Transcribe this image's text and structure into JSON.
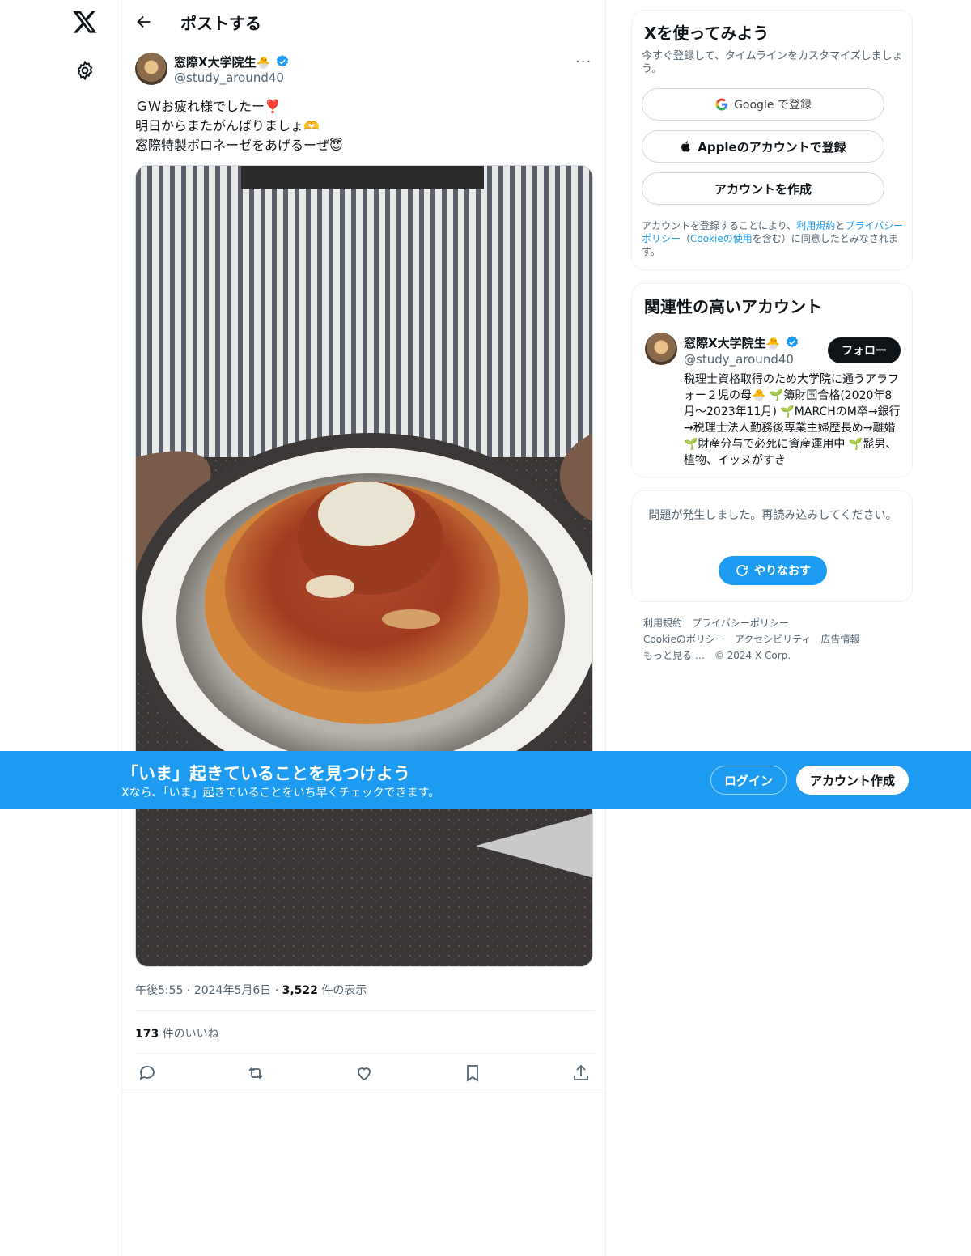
{
  "header": {
    "title": "ポストする"
  },
  "post": {
    "author_name": "窓際X大学院生",
    "author_emoji": "🐣",
    "author_handle": "@study_around40",
    "text_lines": [
      "ＧＷお疲れ様でしたー❣️",
      "明日からまたがんばりましょ🫶",
      "窓際特製ボロネーゼをあげるーぜ😇"
    ],
    "time": "午後5:55",
    "date": "2024年5月6日",
    "views_count": "3,522",
    "views_label": "件の表示",
    "likes_count": "173",
    "likes_label": "件のいいね",
    "more_label": "···"
  },
  "signup_card": {
    "title": "Xを使ってみよう",
    "subtitle": "今すぐ登録して、タイムラインをカスタマイズしましょう。",
    "google_label": "Google で登録",
    "apple_label": "Appleのアカウントで登録",
    "create_label": "アカウントを作成",
    "legal_prefix": "アカウントを登録することにより、",
    "legal_terms": "利用規約",
    "legal_and": "と",
    "legal_privacy": "プライバシーポリシー",
    "legal_paren_open": "（",
    "legal_cookie": "Cookieの使用",
    "legal_suffix": "を含む）に同意したとみなされます。"
  },
  "related": {
    "title": "関連性の高いアカウント",
    "name": "窓際X大学院生",
    "emoji": "🐣",
    "handle": "@study_around40",
    "follow_label": "フォロー",
    "bio": "税理士資格取得のため大学院に通うアラフォー２児の母🐣 🌱簿財国合格(2020年8月〜2023年11月) 🌱MARCHのM卒→銀行→税理士法人勤務後専業主婦歴長め→離婚 🌱財産分与で必死に資産運用中 🌱髭男、植物、イッヌがすき"
  },
  "error_card": {
    "message": "問題が発生しました。再読み込みしてください。",
    "retry_label": "やりなおす"
  },
  "footer": {
    "links": [
      "利用規約",
      "プライバシーポリシー",
      "Cookieのポリシー",
      "アクセシビリティ",
      "広告情報",
      "もっと見る …",
      "© 2024 X Corp."
    ]
  },
  "banner": {
    "title": "「いま」起きていることを見つけよう",
    "subtitle": "Xなら、「いま」起きていることをいち早くチェックできます。",
    "login_label": "ログイン",
    "signup_label": "アカウント作成"
  },
  "colors": {
    "accent": "#1d9bf0",
    "text": "#0f1419",
    "secondary": "#536471",
    "border": "#eff3f4"
  },
  "icons": [
    "x-logo-icon",
    "gear-icon",
    "back-arrow-icon",
    "verified-icon",
    "more-icon",
    "reply-icon",
    "repost-icon",
    "like-icon",
    "bookmark-icon",
    "share-icon",
    "google-icon",
    "apple-icon",
    "refresh-icon"
  ]
}
